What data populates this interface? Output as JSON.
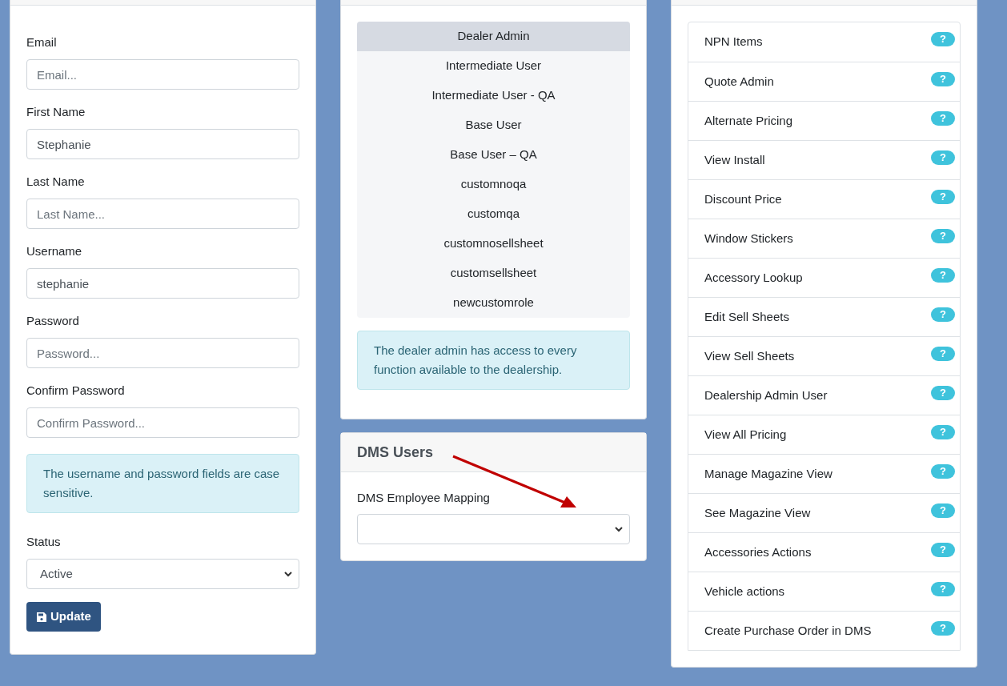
{
  "user_form": {
    "fields": [
      {
        "kind": "input",
        "label": "Email",
        "placeholder": "Email..."
      },
      {
        "kind": "input",
        "label": "First Name",
        "value": "Stephanie"
      },
      {
        "kind": "input",
        "label": "Last Name",
        "placeholder": "Last Name..."
      },
      {
        "kind": "input",
        "label": "Username",
        "value": "stephanie"
      },
      {
        "kind": "input",
        "label": "Password",
        "placeholder": "Password..."
      },
      {
        "kind": "input",
        "label": "Confirm Password",
        "placeholder": "Confirm Password..."
      },
      {
        "kind": "alert",
        "text": "The username and password fields are case sensitive."
      },
      {
        "kind": "select",
        "label": "Status",
        "value": "Active"
      }
    ],
    "button": "Update"
  },
  "roles": {
    "items": [
      {
        "label": "Dealer Admin",
        "selected": true
      },
      {
        "label": "Intermediate User",
        "selected": false
      },
      {
        "label": "Intermediate User - QA",
        "selected": false
      },
      {
        "label": "Base User",
        "selected": false
      },
      {
        "label": "Base User – QA",
        "selected": false
      },
      {
        "label": "customnoqa",
        "selected": false
      },
      {
        "label": "customqa",
        "selected": false
      },
      {
        "label": "customnosellsheet",
        "selected": false
      },
      {
        "label": "customsellsheet",
        "selected": false
      },
      {
        "label": "newcustomrole",
        "selected": false
      }
    ],
    "description": "The dealer admin has access to every function available to the dealership."
  },
  "dms_users": {
    "title": "DMS Users",
    "label": "DMS Employee Mapping"
  },
  "permissions": [
    {
      "label": "NPN Items",
      "badge": "?"
    },
    {
      "label": "Quote Admin",
      "badge": "?"
    },
    {
      "label": "Alternate Pricing",
      "badge": "?"
    },
    {
      "label": "View Install",
      "badge": "?"
    },
    {
      "label": "Discount Price",
      "badge": "?"
    },
    {
      "label": "Window Stickers",
      "badge": "?"
    },
    {
      "label": "Accessory Lookup",
      "badge": "?"
    },
    {
      "label": "Edit Sell Sheets",
      "badge": "?"
    },
    {
      "label": "View Sell Sheets",
      "badge": "?"
    },
    {
      "label": "Dealership Admin User",
      "badge": "?"
    },
    {
      "label": "View All Pricing",
      "badge": "?"
    },
    {
      "label": "Manage Magazine View",
      "badge": "?"
    },
    {
      "label": "See Magazine View",
      "badge": "?"
    },
    {
      "label": "Accessories Actions",
      "badge": "?"
    },
    {
      "label": "Vehicle actions",
      "badge": "?"
    },
    {
      "label": "Create Purchase Order in DMS",
      "badge": "?"
    }
  ]
}
